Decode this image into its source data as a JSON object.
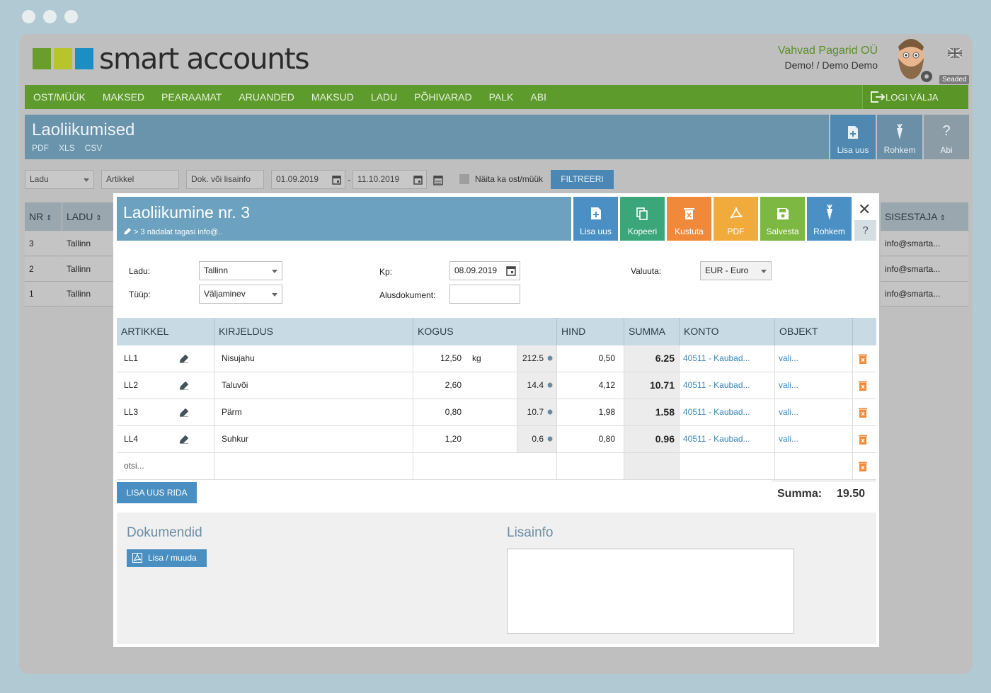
{
  "app": {
    "logo_text": "smart accounts",
    "logo_colors": [
      "#6a9e2c",
      "#b7c42b",
      "#1a8fc4"
    ],
    "company": "Vahvad Pagarid OÜ",
    "user": "Demo! / Demo Demo",
    "settings_label": "Seaded"
  },
  "nav": {
    "items": [
      "OST/MÜÜK",
      "MAKSED",
      "PEARAAMAT",
      "ARUANDED",
      "MAKSUD",
      "LADU",
      "PÕHIVARAD",
      "PALK",
      "ABI"
    ],
    "logout": "LOGI VÄLJA"
  },
  "page": {
    "title": "Laoliikumised",
    "exports": [
      "PDF",
      "XLS",
      "CSV"
    ],
    "buttons": {
      "add": "Lisa uus",
      "more": "Rohkem",
      "help": "Abi",
      "help_glyph": "?"
    }
  },
  "filters": {
    "warehouse_placeholder": "Ladu",
    "article_placeholder": "Artikkel",
    "doc_placeholder": "Dok. või lisainfo",
    "date_from": "01.09.2019",
    "date_sep": "-",
    "date_to": "11.10.2019",
    "show_label": "Näita ka ost/müük",
    "filter_button": "FILTREERI"
  },
  "bg_table": {
    "headers": {
      "nr": "NR",
      "ladu": "LADU",
      "sisestaja": "SISESTAJA"
    },
    "rows": [
      {
        "nr": "3",
        "ladu": "Tallinn",
        "sisestaja": "info@smarta..."
      },
      {
        "nr": "2",
        "ladu": "Tallinn",
        "sisestaja": "info@smarta..."
      },
      {
        "nr": "1",
        "ladu": "Tallinn",
        "sisestaja": "info@smarta..."
      }
    ]
  },
  "modal": {
    "title": "Laoliikumine nr. 3",
    "subtitle": "> 3 nädalat tagasi info@..",
    "buttons": {
      "add": "Lisa uus",
      "copy": "Kopeeri",
      "delete": "Kustuta",
      "pdf": "PDF",
      "save": "Salvesta",
      "more": "Rohkem"
    },
    "button_colors": {
      "add": "#4a90c4",
      "copy": "#3aa67a",
      "delete": "#f08a3a",
      "pdf": "#f0ab3c",
      "save": "#7cb842",
      "more": "#4a90c4"
    },
    "close_glyph": "✕",
    "help_glyph": "?",
    "form": {
      "ladu_label": "Ladu:",
      "ladu_value": "Tallinn",
      "tyyp_label": "Tüüp:",
      "tyyp_value": "Väljaminev",
      "kp_label": "Kp:",
      "kp_value": "08.09.2019",
      "alus_label": "Alusdokument:",
      "alus_value": "",
      "valuuta_label": "Valuuta:",
      "valuuta_value": "EUR - Euro"
    },
    "table": {
      "headers": {
        "artikkel": "ARTIKKEL",
        "kirjeldus": "KIRJELDUS",
        "kogus": "KOGUS",
        "hind": "HIND",
        "summa": "SUMMA",
        "konto": "KONTO",
        "objekt": "OBJEKT"
      },
      "rows": [
        {
          "artikkel": "LL1",
          "kirjeldus": "Nisujahu",
          "kogus": "12,50",
          "unit": "kg",
          "stock": "212.5",
          "hind": "0,50",
          "summa": "6.25",
          "konto": "40511 - Kaubad...",
          "objekt": "vali..."
        },
        {
          "artikkel": "LL2",
          "kirjeldus": "Taluvõi",
          "kogus": "2,60",
          "unit": "",
          "stock": "14.4",
          "hind": "4,12",
          "summa": "10.71",
          "konto": "40511 - Kaubad...",
          "objekt": "vali..."
        },
        {
          "artikkel": "LL3",
          "kirjeldus": "Pärm",
          "kogus": "0,80",
          "unit": "",
          "stock": "10.7",
          "hind": "1,98",
          "summa": "1.58",
          "konto": "40511 - Kaubad...",
          "objekt": "vali..."
        },
        {
          "artikkel": "LL4",
          "kirjeldus": "Suhkur",
          "kogus": "1,20",
          "unit": "",
          "stock": "0.6",
          "hind": "0,80",
          "summa": "0.96",
          "konto": "40511 - Kaubad...",
          "objekt": "vali..."
        }
      ],
      "search_placeholder": "otsi..."
    },
    "add_row": "LISA UUS RIDA",
    "total_label": "Summa:",
    "total_value": "19.50",
    "docs_title": "Dokumendid",
    "docs_button": "Lisa / muuda",
    "info_title": "Lisainfo"
  }
}
